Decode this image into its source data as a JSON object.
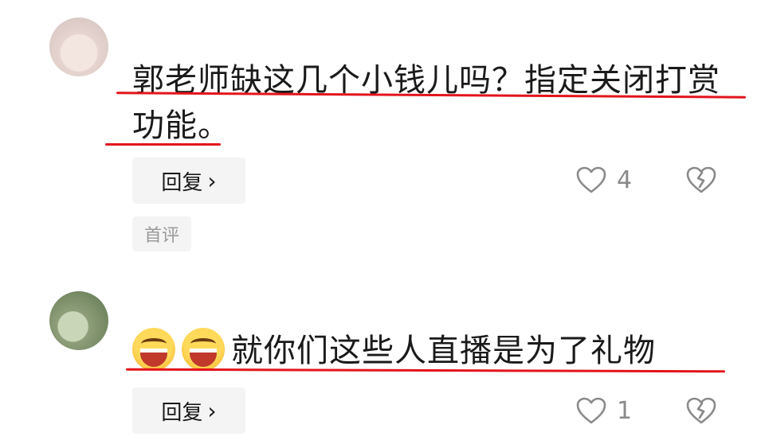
{
  "comments": [
    {
      "text_line1": "郭老师缺这几个小钱儿吗？指定关闭打赏",
      "text_line2": "功能。",
      "reply_label": "回复",
      "reply_chevron": "›",
      "like_count": "4",
      "badge": "首评"
    },
    {
      "text": "就你们这些人直播是为了礼物",
      "emoji_icons": [
        "grinning-squint-face-icon",
        "grinning-squint-face-icon"
      ],
      "reply_label": "回复",
      "reply_chevron": "›",
      "like_count": "1"
    }
  ],
  "colors": {
    "underline": "#e3141c",
    "icon_gray": "#8a8a8a",
    "button_bg": "#f4f4f4"
  }
}
